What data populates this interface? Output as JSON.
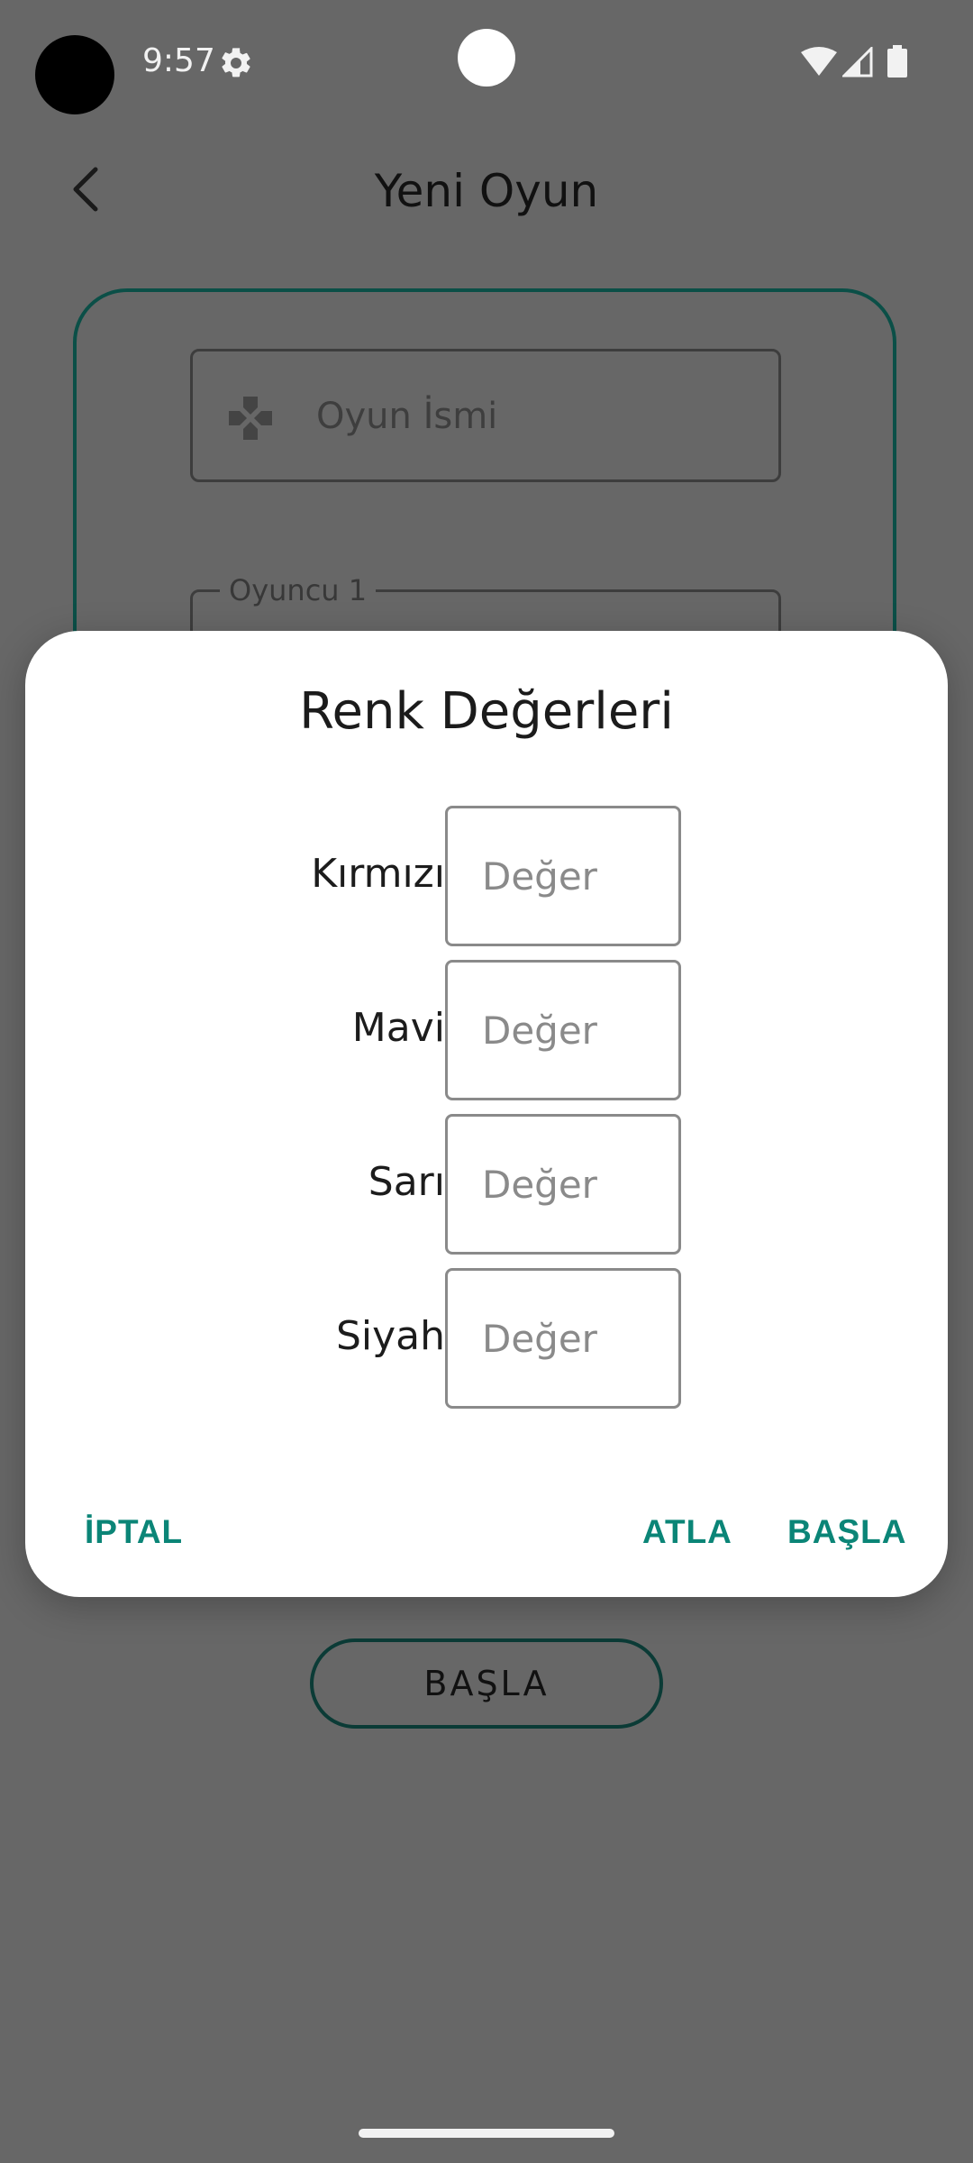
{
  "status_bar": {
    "time": "9:57",
    "icons": [
      "settings-icon",
      "wifi-icon",
      "signal-icon",
      "battery-icon"
    ]
  },
  "app_bar": {
    "title": "Yeni Oyun",
    "back_icon": "chevron-left-icon"
  },
  "form": {
    "game_name_placeholder": "Oyun İsmi",
    "game_name_icon": "gamepad-icon",
    "player1_label": "Oyuncu 1",
    "start_button": "BAŞLA",
    "card_border_color": "#0b4f47"
  },
  "dialog": {
    "title": "Renk Değerleri",
    "rows": [
      {
        "label": "Kırmızı",
        "placeholder": "Değer"
      },
      {
        "label": "Mavi",
        "placeholder": "Değer"
      },
      {
        "label": "Sarı",
        "placeholder": "Değer"
      },
      {
        "label": "Siyah",
        "placeholder": "Değer"
      }
    ],
    "actions": {
      "cancel": "İPTAL",
      "skip": "ATLA",
      "start": "BAŞLA"
    },
    "accent_color": "#0b8577"
  },
  "colors": {
    "scrim": "#676767",
    "dialog_background": "#ffffff"
  }
}
